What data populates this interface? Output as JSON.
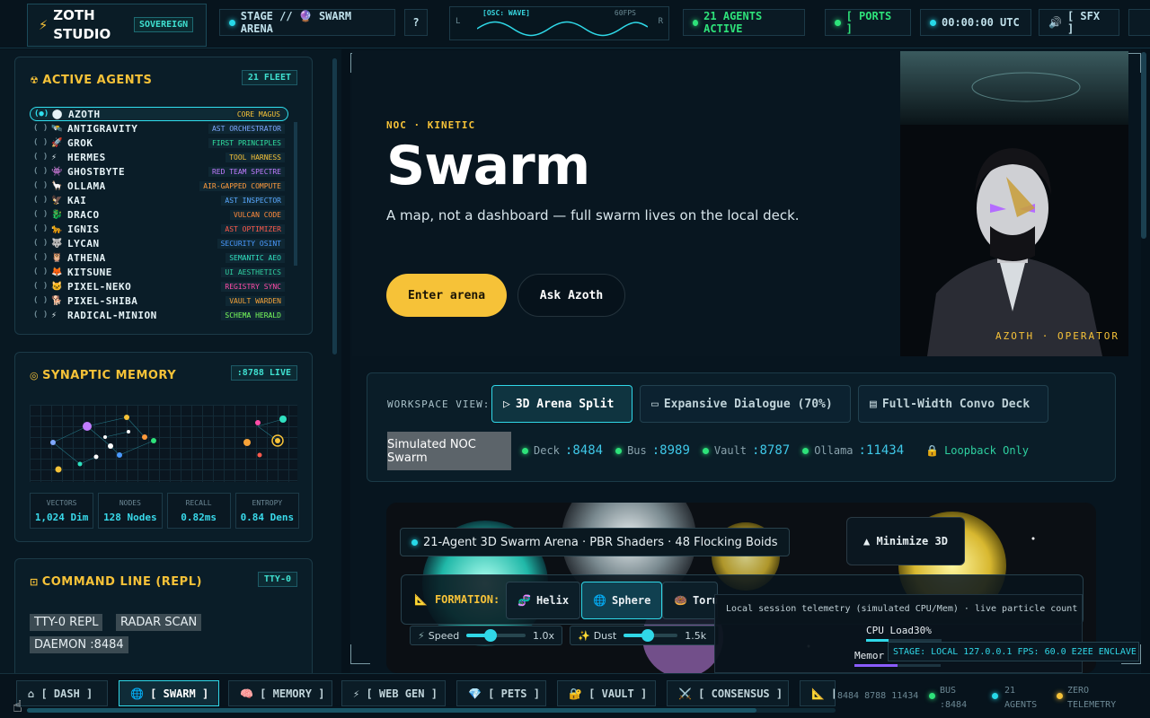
{
  "brand": {
    "name": "ZOTH STUDIO",
    "badge": "SOVEREIGN"
  },
  "topbar": {
    "stage": "STAGE // 🔮 SWARM ARENA",
    "help": "?",
    "osc": {
      "title": "[OSC: WAVE]",
      "fps": "60FPS",
      "left": "L",
      "right": "R"
    },
    "agents_active": "21 AGENTS ACTIVE",
    "ports": "[ PORTS ]",
    "clock": "00:00:00 UTC",
    "sfx": "[ SFX ]"
  },
  "agents_panel": {
    "title": "ACTIVE AGENTS",
    "badge": "21 FLEET",
    "items": [
      {
        "emoji": "⬤",
        "name": "AZOTH",
        "role": "CORE MAGUS",
        "color": "#f6c238"
      },
      {
        "emoji": "🛰️",
        "name": "ANTIGRAVITY",
        "role": "AST ORCHESTRATOR",
        "color": "#7fa8ff"
      },
      {
        "emoji": "🚀",
        "name": "GROK",
        "role": "FIRST PRINCIPLES",
        "color": "#30e0a0"
      },
      {
        "emoji": "⚡",
        "name": "HERMES",
        "role": "TOOL HARNESS",
        "color": "#f6c238"
      },
      {
        "emoji": "👾",
        "name": "GHOSTBYTE",
        "role": "RED TEAM SPECTRE",
        "color": "#c07cff"
      },
      {
        "emoji": "🦙",
        "name": "OLLAMA",
        "role": "AIR-GAPPED COMPUTE",
        "color": "#ff9a3c"
      },
      {
        "emoji": "🦅",
        "name": "KAI",
        "role": "AST INSPECTOR",
        "color": "#5aa8ff"
      },
      {
        "emoji": "🐉",
        "name": "DRACO",
        "role": "VULCAN CODE",
        "color": "#ff8a3c"
      },
      {
        "emoji": "🐆",
        "name": "IGNIS",
        "role": "AST OPTIMIZER",
        "color": "#ff5a4c"
      },
      {
        "emoji": "🐺",
        "name": "LYCAN",
        "role": "SECURITY OSINT",
        "color": "#4a9aff"
      },
      {
        "emoji": "🦉",
        "name": "ATHENA",
        "role": "SEMANTIC AEO",
        "color": "#30e0c0"
      },
      {
        "emoji": "🦊",
        "name": "KITSUNE",
        "role": "UI AESTHETICS",
        "color": "#30d0a0"
      },
      {
        "emoji": "🐱",
        "name": "PIXEL-NEKO",
        "role": "REGISTRY SYNC",
        "color": "#ff4ca8"
      },
      {
        "emoji": "🐕",
        "name": "PIXEL-SHIBA",
        "role": "VAULT WARDEN",
        "color": "#f6a238"
      },
      {
        "emoji": "⚡",
        "name": "RADICAL-MINION",
        "role": "SCHEMA HERALD",
        "color": "#7aff5c"
      }
    ]
  },
  "memory_panel": {
    "title": "SYNAPTIC MEMORY",
    "badge": ":8788 LIVE",
    "stats": [
      {
        "label": "VECTORS",
        "value": "1,024 Dim"
      },
      {
        "label": "NODES",
        "value": "128 Nodes"
      },
      {
        "label": "RECALL",
        "value": "0.82ms"
      },
      {
        "label": "ENTROPY",
        "value": "0.84 Dens"
      }
    ]
  },
  "repl_panel": {
    "title": "COMMAND LINE (REPL)",
    "badge": "TTY-0",
    "tags": [
      "TTY-0 REPL",
      "RADAR SCAN",
      "DAEMON :8484"
    ]
  },
  "hero": {
    "eyebrow": "NOC · KINETIC",
    "title": "Swarm",
    "subtitle": "A map, not a dashboard — full swarm lives on the local deck.",
    "primary": "Enter arena",
    "secondary": "Ask Azoth",
    "portrait_caption": "AZOTH · OPERATOR"
  },
  "workspace": {
    "label": "WORKSPACE VIEW:",
    "views": [
      "3D Arena Split",
      "Expansive Dialogue (70%)",
      "Full-Width Convo Deck"
    ],
    "sim": "Simulated NOC Swarm",
    "ports": [
      {
        "name": "Deck",
        "port": ":8484"
      },
      {
        "name": "Bus",
        "port": ":8989"
      },
      {
        "name": "Vault",
        "port": ":8787"
      },
      {
        "name": "Ollama",
        "port": ":11434"
      }
    ],
    "loopback": "Loopback Only"
  },
  "arena": {
    "header": "21-Agent 3D Swarm Arena · PBR Shaders · 48 Flocking Boids",
    "minimize": "▲ Minimize 3D",
    "formation_label": "FORMATION:",
    "formations": [
      "Helix",
      "Sphere",
      "Toru"
    ],
    "speed_label": "Speed",
    "speed_value": "1.0x",
    "dust_label": "Dust",
    "dust_value": "1.5k",
    "telemetry": "Local session telemetry (simulated CPU/Mem) · live particle count",
    "cpu": "CPU Load30%",
    "cpu_level": 0.3,
    "mem": "Memor",
    "stage": "STAGE: LOCAL 127.0.0.1 FPS: 60.0 E2EE ENCLAVE"
  },
  "bottom": {
    "tabs": [
      "⌂ [ DASH ]",
      "🌐 [ SWARM ]",
      "🧠 [ MEMORY ]",
      "⚡ [ WEB GEN ]",
      "💎 [ PETS ]",
      "🔐 [ VAULT ]",
      "⚔️ [ CONSENSUS ]",
      "📐 ["
    ],
    "ports_text": "8484 8788 11434",
    "bus": "BUS :8484",
    "agents": "21 AGENTS",
    "zero": "ZERO TELEMETRY"
  }
}
